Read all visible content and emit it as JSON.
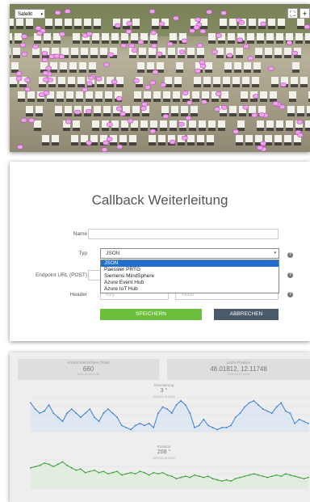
{
  "map": {
    "layer_label": "Satellit",
    "layer_caret": "▾",
    "fullscreen_label": "⛶",
    "zoom_in_label": "+"
  },
  "form": {
    "title": "Callback Weiterleitung",
    "name_label": "Name",
    "type_label": "Typ",
    "type_value": "JSON",
    "type_caret": "▾",
    "endpoint_label": "Endpoint URL (POST)",
    "header_label": "Header",
    "header_key_placeholder": "Key",
    "header_value_placeholder": "Value",
    "help_glyph": "?",
    "type_options": [
      "JSON",
      "Paessler PRTG",
      "Siemens MindSphere",
      "Azure Event Hub",
      "Azure IoT Hub"
    ],
    "selected_option": "JSON",
    "save_label": "SPEICHERN",
    "cancel_label": "ABBRECHEN"
  },
  "dashboard": {
    "stat_left": {
      "title": "Anzahl Nachrichten (Total)",
      "value": "660",
      "sub": "2022-03-10 10:32"
    },
    "stat_right": {
      "title": "Letzte Position",
      "value": "48.01812, 12.11748",
      "sub": "2022-03-10 10:32"
    },
    "chart1": {
      "title": "Orientierung",
      "value": "3 °",
      "sub": "2022-03-10 10:32",
      "color": "#3d7fd6"
    },
    "chart2": {
      "title": "Rotation",
      "value": "208 °",
      "sub": "2022-03-10 10:32",
      "color": "#3f9f3a"
    }
  },
  "chart_data": [
    {
      "type": "area",
      "title": "Orientierung",
      "values": [
        14,
        11,
        9,
        10,
        13,
        9,
        7,
        5,
        9,
        11,
        9,
        7,
        9,
        11,
        7,
        5,
        9,
        11,
        9,
        7,
        3,
        2,
        1,
        3,
        4,
        3,
        4,
        2,
        9,
        12,
        11,
        9,
        13,
        15,
        13,
        9,
        2,
        3,
        6,
        3,
        2,
        1,
        2,
        2,
        3,
        7,
        9,
        12,
        14,
        15,
        13,
        11,
        10,
        9,
        12,
        14,
        10,
        9,
        4,
        6,
        5,
        4
      ]
    },
    {
      "type": "area",
      "title": "Rotation",
      "values": [
        17,
        18,
        19,
        21,
        20,
        18,
        20,
        22,
        19,
        17,
        15,
        16,
        13,
        14,
        15,
        13,
        14,
        12,
        13,
        14,
        11,
        12,
        13,
        12,
        14,
        13,
        11,
        13,
        12,
        13,
        11,
        10,
        8,
        9,
        10,
        9,
        11,
        10,
        9,
        10,
        8,
        7,
        6,
        7,
        6,
        8,
        9,
        10,
        11,
        12,
        11,
        10,
        9,
        10,
        11,
        10,
        12,
        11,
        10,
        9,
        8,
        9
      ]
    }
  ]
}
